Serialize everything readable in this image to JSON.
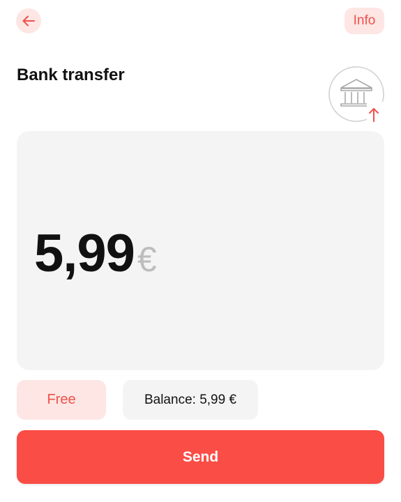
{
  "header": {
    "back_icon": "arrow-left-icon",
    "info_label": "Info"
  },
  "title": "Bank transfer",
  "badge": {
    "bank_icon": "bank-building-icon",
    "arrow_icon": "arrow-up-icon"
  },
  "amount": {
    "value": "5,99",
    "currency": "€"
  },
  "fee_label": "Free",
  "balance_label": "Balance: 5,99 €",
  "send_label": "Send",
  "colors": {
    "accent": "#fa4d45",
    "accent_soft": "#fde6e4",
    "card_bg": "#f4f4f4"
  }
}
